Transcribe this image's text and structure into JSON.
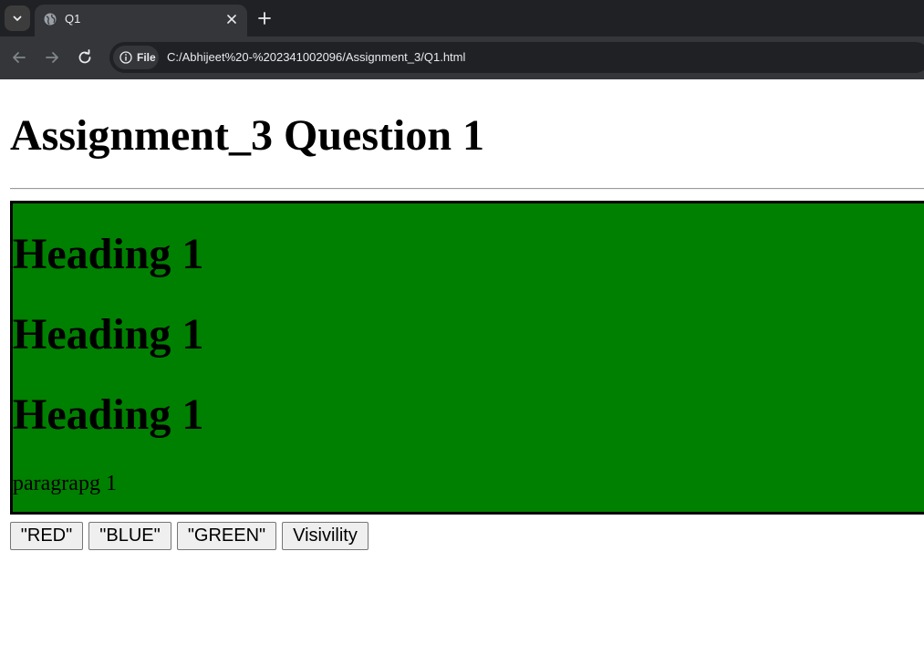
{
  "browser": {
    "tab_title": "Q1",
    "security_chip_label": "File",
    "url": "C:/Abhijeet%20-%202341002096/Assignment_3/Q1.html"
  },
  "page": {
    "title": "Assignment_3 Question 1",
    "box": {
      "background_color": "#008000",
      "headings": [
        "Heading 1",
        "Heading 1",
        "Heading 1"
      ],
      "paragraph": "paragrapg 1"
    },
    "buttons": [
      "\"RED\"",
      "\"BLUE\"",
      "\"GREEN\"",
      "Visivility"
    ]
  }
}
